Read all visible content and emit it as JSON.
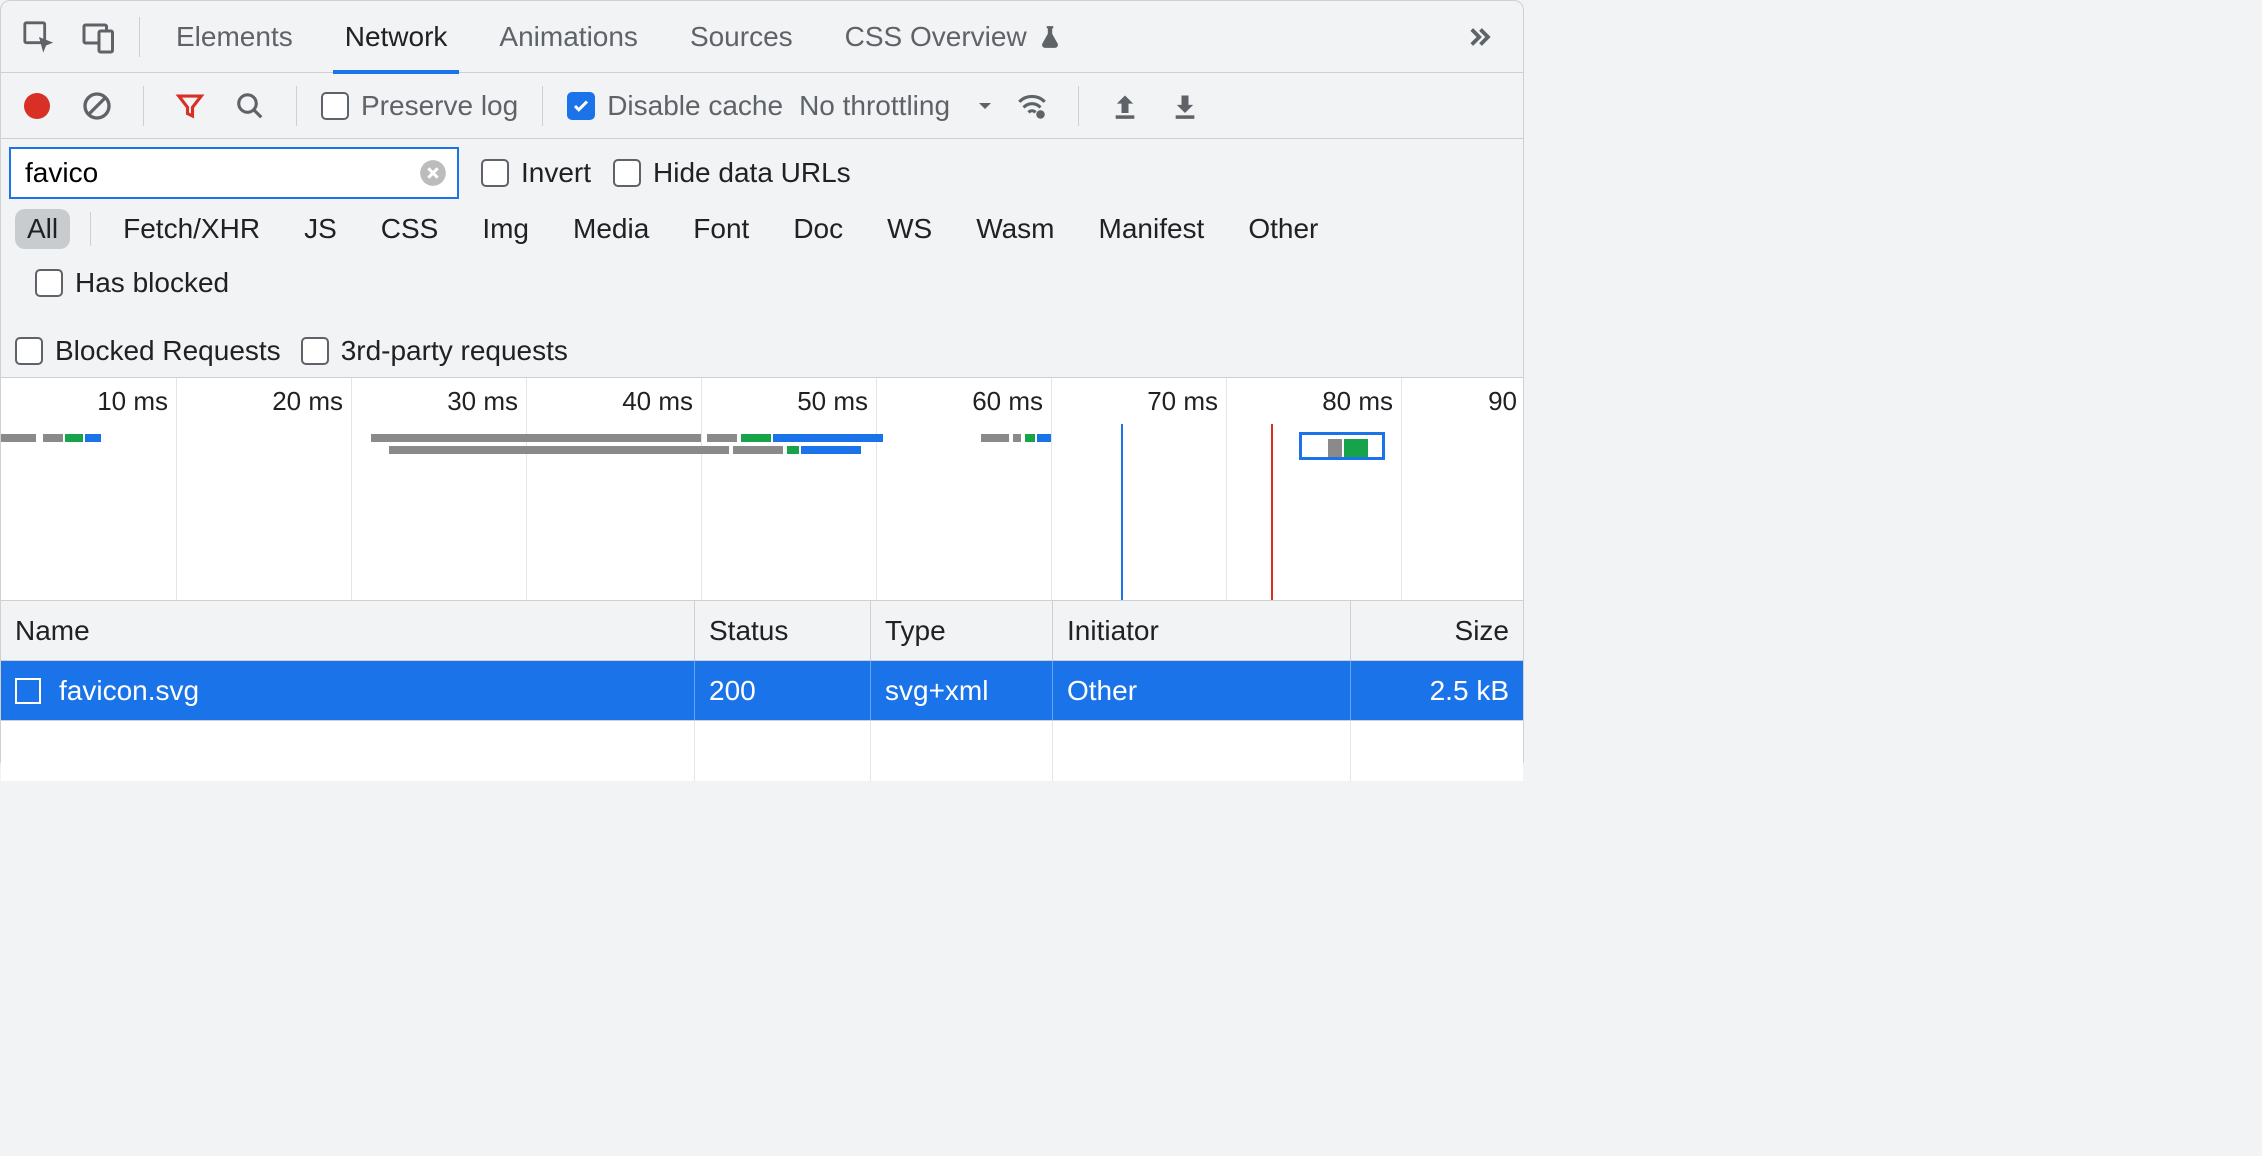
{
  "tabs": {
    "elements": "Elements",
    "network": "Network",
    "animations": "Animations",
    "sources": "Sources",
    "css_overview": "CSS Overview"
  },
  "toolbar": {
    "preserve_log": "Preserve log",
    "preserve_log_checked": false,
    "disable_cache": "Disable cache",
    "disable_cache_checked": true,
    "throttling": "No throttling"
  },
  "filter": {
    "value": "favico",
    "invert": "Invert",
    "hide_data_urls": "Hide data URLs"
  },
  "types": {
    "all": "All",
    "fetch": "Fetch/XHR",
    "js": "JS",
    "css": "CSS",
    "img": "Img",
    "media": "Media",
    "font": "Font",
    "doc": "Doc",
    "ws": "WS",
    "wasm": "Wasm",
    "manifest": "Manifest",
    "other": "Other",
    "has_blocked": "Has blocked",
    "blocked": "Blocked Requests",
    "third": "3rd-party requests"
  },
  "timeline": {
    "ticks": [
      "10 ms",
      "20 ms",
      "30 ms",
      "40 ms",
      "50 ms",
      "60 ms",
      "70 ms",
      "80 ms",
      "90 "
    ]
  },
  "columns": {
    "name": "Name",
    "status": "Status",
    "type": "Type",
    "initiator": "Initiator",
    "size": "Size"
  },
  "row": {
    "name": "favicon.svg",
    "status": "200",
    "type": "svg+xml",
    "initiator": "Other",
    "size": "2.5 kB"
  }
}
